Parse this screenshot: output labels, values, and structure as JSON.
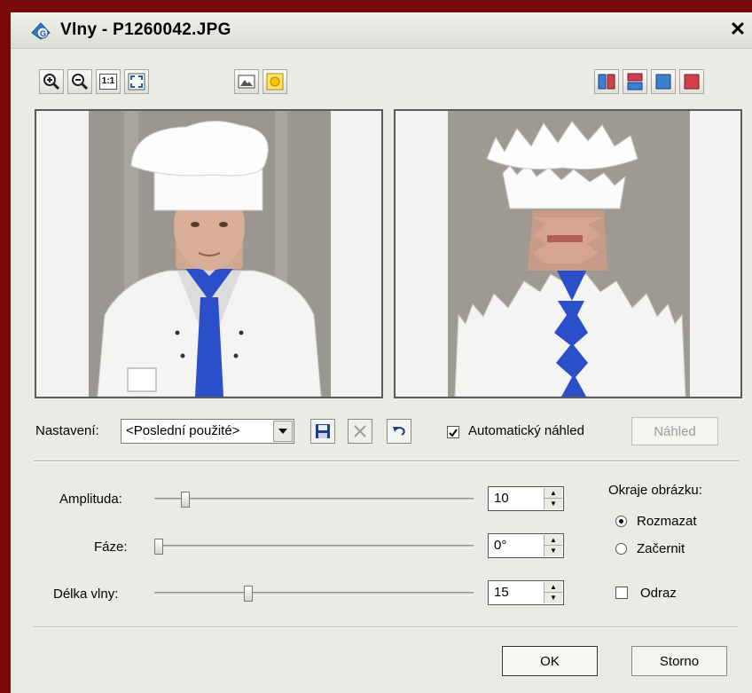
{
  "window": {
    "title": "Vlny - P1260042.JPG",
    "close_label": "✕"
  },
  "toolbar": {
    "left": [
      {
        "name": "zoom-in-icon"
      },
      {
        "name": "zoom-out-icon"
      },
      {
        "name": "actual-size-icon",
        "label": "1:1"
      },
      {
        "name": "fit-to-window-icon"
      },
      {
        "name": "image-icon"
      },
      {
        "name": "sun-icon"
      }
    ],
    "right": [
      {
        "name": "split-vertical-icon"
      },
      {
        "name": "split-horizontal-icon"
      },
      {
        "name": "original-view-icon"
      },
      {
        "name": "result-view-icon"
      }
    ]
  },
  "preset": {
    "label": "Nastavení:",
    "selected": "<Poslední použité>",
    "save_icon": "save-icon",
    "delete_icon": "delete-icon",
    "undo_icon": "undo-icon"
  },
  "auto_preview": {
    "label": "Automatický náhled",
    "checked": true
  },
  "preview_button": {
    "label": "Náhled",
    "enabled": false
  },
  "params": {
    "amplitude": {
      "label": "Amplituda:",
      "value": "10"
    },
    "phase": {
      "label": "Fáze:",
      "value": "0°"
    },
    "wavelength": {
      "label": "Délka vlny:",
      "value": "15"
    }
  },
  "edges": {
    "label": "Okraje obrázku:",
    "options": [
      {
        "label": "Rozmazat",
        "selected": true
      },
      {
        "label": "Začernit",
        "selected": false
      }
    ]
  },
  "reflect": {
    "label": "Odraz",
    "checked": false
  },
  "buttons": {
    "ok": "OK",
    "cancel": "Storno"
  },
  "colors": {
    "frame_bg": "#7a0a0a",
    "dialog_bg": "#ebebe6",
    "tie_blue": "#2a4fc8"
  }
}
